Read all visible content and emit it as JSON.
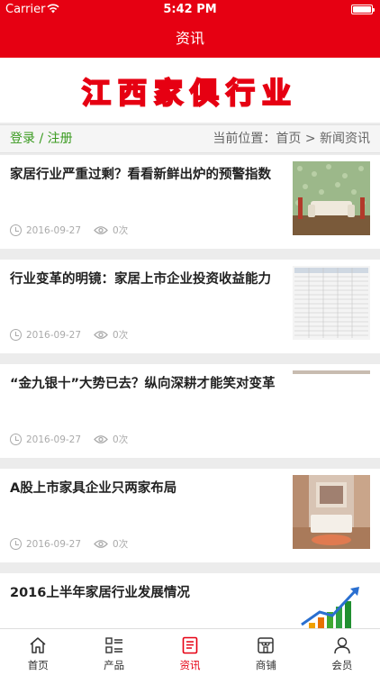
{
  "status_bar": {
    "carrier": "Carrier",
    "time": "5:42 PM"
  },
  "header": {
    "title": "资讯"
  },
  "banner": {
    "text": "江西家俱行业"
  },
  "breadcrumb": {
    "login": "登录",
    "separator": "/",
    "register": "注册",
    "location_label": "当前位置：",
    "home": "首页",
    "arrow": ">",
    "current": "新闻资讯"
  },
  "articles": [
    {
      "title": "家居行业严重过剩？看看新鲜出炉的预警指数",
      "date": "2016-09-27",
      "views": "0次",
      "thumb": "living-room-sofa"
    },
    {
      "title": "行业变革的明镜：家居上市企业投资收益能力",
      "date": "2016-09-27",
      "views": "0次",
      "thumb": "data-table"
    },
    {
      "title": "“金九银十”大势已去？纵向深耕才能笑对变革",
      "date": "2016-09-27",
      "views": "0次",
      "thumb": "blank-strip"
    },
    {
      "title": "A股上市家具企业只两家布局",
      "date": "2016-09-27",
      "views": "0次",
      "thumb": "bedroom"
    },
    {
      "title": "2016上半年家居行业发展情况",
      "date": "",
      "views": "",
      "thumb": "growth-bar-chart"
    }
  ],
  "tabs": [
    {
      "label": "首页",
      "icon": "home-icon",
      "active": false
    },
    {
      "label": "产品",
      "icon": "grid-list-icon",
      "active": false
    },
    {
      "label": "资讯",
      "icon": "document-icon",
      "active": true
    },
    {
      "label": "商铺",
      "icon": "store-icon",
      "active": false
    },
    {
      "label": "会员",
      "icon": "user-icon",
      "active": false
    }
  ],
  "colors": {
    "brand_red": "#e60012",
    "link_green": "#3a9a20"
  }
}
